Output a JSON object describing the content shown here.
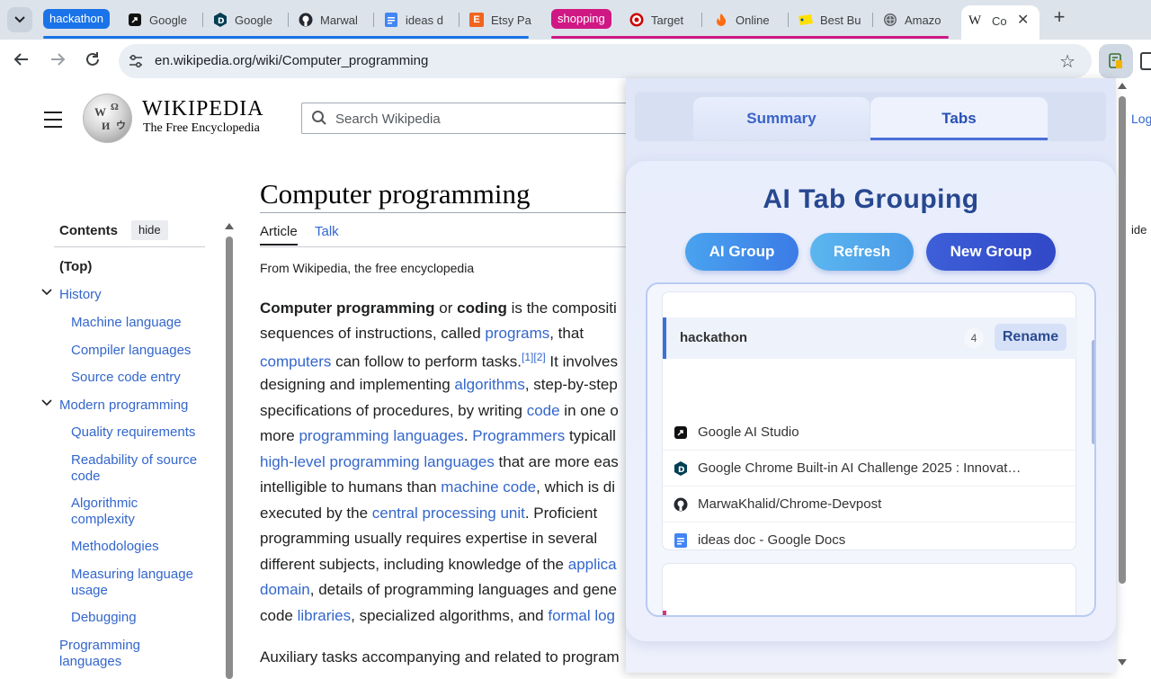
{
  "browser": {
    "group_chips": [
      {
        "label": "hackathon",
        "color": "#1a73e8"
      },
      {
        "label": "shopping",
        "color": "#d01884"
      }
    ],
    "tabs": [
      {
        "title": "Google",
        "icon": "ai-studio-icon"
      },
      {
        "title": "Google",
        "icon": "devpost-icon"
      },
      {
        "title": "Marwal",
        "icon": "github-icon"
      },
      {
        "title": "ideas d",
        "icon": "docs-icon"
      },
      {
        "title": "Etsy Pa",
        "icon": "etsy-icon"
      },
      {
        "title": "Target",
        "icon": "target-icon"
      },
      {
        "title": "Online",
        "icon": "flame-icon"
      },
      {
        "title": "Best Bu",
        "icon": "bestbuy-icon"
      },
      {
        "title": "Amazo",
        "icon": "globe-icon"
      }
    ],
    "active_tab": {
      "favicon": "W",
      "title": "Co",
      "close": "✕"
    },
    "new_tab": "+",
    "url": "en.wikipedia.org/wiki/Computer_programming"
  },
  "wiki": {
    "wordmark": "WIKIPEDIA",
    "tagline": "The Free Encyclopedia",
    "search_placeholder": "Search Wikipedia",
    "right_link": "Log",
    "right_hide": "ide",
    "toc": {
      "title": "Contents",
      "hide": "hide",
      "items": [
        {
          "label": "(Top)"
        },
        {
          "label": "History"
        },
        {
          "label": "Machine language"
        },
        {
          "label": "Compiler languages"
        },
        {
          "label": "Source code entry"
        },
        {
          "label": "Modern programming"
        },
        {
          "label": "Quality requirements"
        },
        {
          "label": "Readability of source code"
        },
        {
          "label": "Algorithmic complexity"
        },
        {
          "label": "Methodologies"
        },
        {
          "label": "Measuring language usage"
        },
        {
          "label": "Debugging"
        },
        {
          "label": "Programming languages"
        }
      ]
    },
    "title": "Computer programming",
    "tab_article": "Article",
    "tab_talk": "Talk",
    "from": "From Wikipedia, the free encyclopedia",
    "body": [
      [
        {
          "b": "Computer programming"
        },
        {
          "t": " or "
        },
        {
          "b": "coding"
        },
        {
          "t": " is the compositi"
        }
      ],
      [
        {
          "t": "sequences of instructions, called "
        },
        {
          "a": "programs"
        },
        {
          "t": ", that"
        }
      ],
      [
        {
          "a": "computers"
        },
        {
          "t": " can follow to perform tasks."
        },
        {
          "s": "[1][2]"
        },
        {
          "t": " It involves"
        }
      ],
      [
        {
          "t": "designing and implementing "
        },
        {
          "a": "algorithms"
        },
        {
          "t": ", step-by-step"
        }
      ],
      [
        {
          "t": "specifications of procedures, by writing "
        },
        {
          "a": "code"
        },
        {
          "t": " in one o"
        }
      ],
      [
        {
          "t": "more "
        },
        {
          "a": "programming languages"
        },
        {
          "t": ". "
        },
        {
          "a": "Programmers"
        },
        {
          "t": " typicall"
        }
      ],
      [
        {
          "a": "high-level programming languages"
        },
        {
          "t": " that are more eas"
        }
      ],
      [
        {
          "t": "intelligible to humans than "
        },
        {
          "a": "machine code"
        },
        {
          "t": ", which is di"
        }
      ],
      [
        {
          "t": "executed by the "
        },
        {
          "a": "central processing unit"
        },
        {
          "t": ". Proficient"
        }
      ],
      [
        {
          "t": "programming usually requires expertise in several"
        }
      ],
      [
        {
          "t": "different subjects, including knowledge of the "
        },
        {
          "a": "applica"
        }
      ],
      [
        {
          "a": "domain"
        },
        {
          "t": ", details of programming languages and gene"
        }
      ],
      [
        {
          "t": "code "
        },
        {
          "a": "libraries"
        },
        {
          "t": ", specialized algorithms, and "
        },
        {
          "a": "formal log"
        }
      ],
      [
        {
          "t": "Auxiliary tasks accompanying and related to program"
        }
      ]
    ]
  },
  "popup": {
    "tab_summary": "Summary",
    "tab_tabs": "Tabs",
    "title": "AI Tab Grouping",
    "btn_ai_group": "AI Group",
    "btn_refresh": "Refresh",
    "btn_new_group": "New Group",
    "group": {
      "name": "hackathon",
      "count": "4",
      "rename": "Rename",
      "accent": "#3b71d6",
      "tabs": [
        {
          "title": "Google AI Studio",
          "icon": "ai-studio-icon"
        },
        {
          "title": "Google Chrome Built-in AI Challenge 2025 : Innovat…",
          "icon": "devpost-icon"
        },
        {
          "title": "MarwaKhalid/Chrome-Devpost",
          "icon": "github-icon"
        },
        {
          "title": "ideas doc - Google Docs",
          "icon": "docs-icon"
        }
      ]
    },
    "next_group_accent": "#d6337f"
  }
}
